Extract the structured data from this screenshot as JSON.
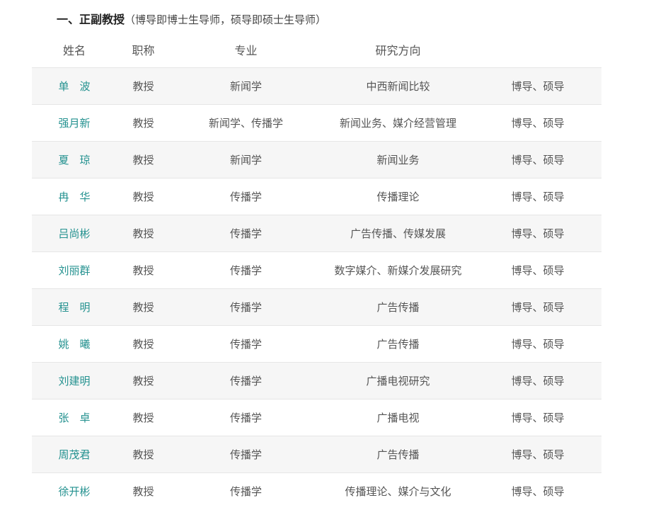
{
  "heading": {
    "number": "一、",
    "title": "正副教授",
    "note": "（博导即博士生导师，硕导即硕士生导师）"
  },
  "table": {
    "headers": [
      "姓名",
      "职称",
      "专业",
      "研究方向",
      ""
    ],
    "rows": [
      {
        "name": "单　波",
        "title": "教授",
        "major": "新闻学",
        "research": "中西新闻比较",
        "advisor": "博导、硕导"
      },
      {
        "name": "强月新",
        "title": "教授",
        "major": "新闻学、传播学",
        "research": "新闻业务、媒介经营管理",
        "advisor": "博导、硕导"
      },
      {
        "name": "夏　琼",
        "title": "教授",
        "major": "新闻学",
        "research": "新闻业务",
        "advisor": "博导、硕导"
      },
      {
        "name": "冉　华",
        "title": "教授",
        "major": "传播学",
        "research": "传播理论",
        "advisor": "博导、硕导"
      },
      {
        "name": "吕尚彬",
        "title": "教授",
        "major": "传播学",
        "research": "广告传播、传媒发展",
        "advisor": "博导、硕导"
      },
      {
        "name": "刘丽群",
        "title": "教授",
        "major": "传播学",
        "research": "数字媒介、新媒介发展研究",
        "advisor": "博导、硕导"
      },
      {
        "name": "程　明",
        "title": "教授",
        "major": "传播学",
        "research": "广告传播",
        "advisor": "博导、硕导"
      },
      {
        "name": "姚　曦",
        "title": "教授",
        "major": "传播学",
        "research": "广告传播",
        "advisor": "博导、硕导"
      },
      {
        "name": "刘建明",
        "title": "教授",
        "major": "传播学",
        "research": "广播电视研究",
        "advisor": "博导、硕导"
      },
      {
        "name": "张　卓",
        "title": "教授",
        "major": "传播学",
        "research": "广播电视",
        "advisor": "博导、硕导"
      },
      {
        "name": "周茂君",
        "title": "教授",
        "major": "传播学",
        "research": "广告传播",
        "advisor": "博导、硕导"
      },
      {
        "name": "徐开彬",
        "title": "教授",
        "major": "传播学",
        "research": "传播理论、媒介与文化",
        "advisor": "博导、硕导"
      }
    ]
  },
  "colors": {
    "name_link": "#23918f",
    "row_stripe": "#f6f6f6",
    "row_border": "#e6e6e6"
  }
}
